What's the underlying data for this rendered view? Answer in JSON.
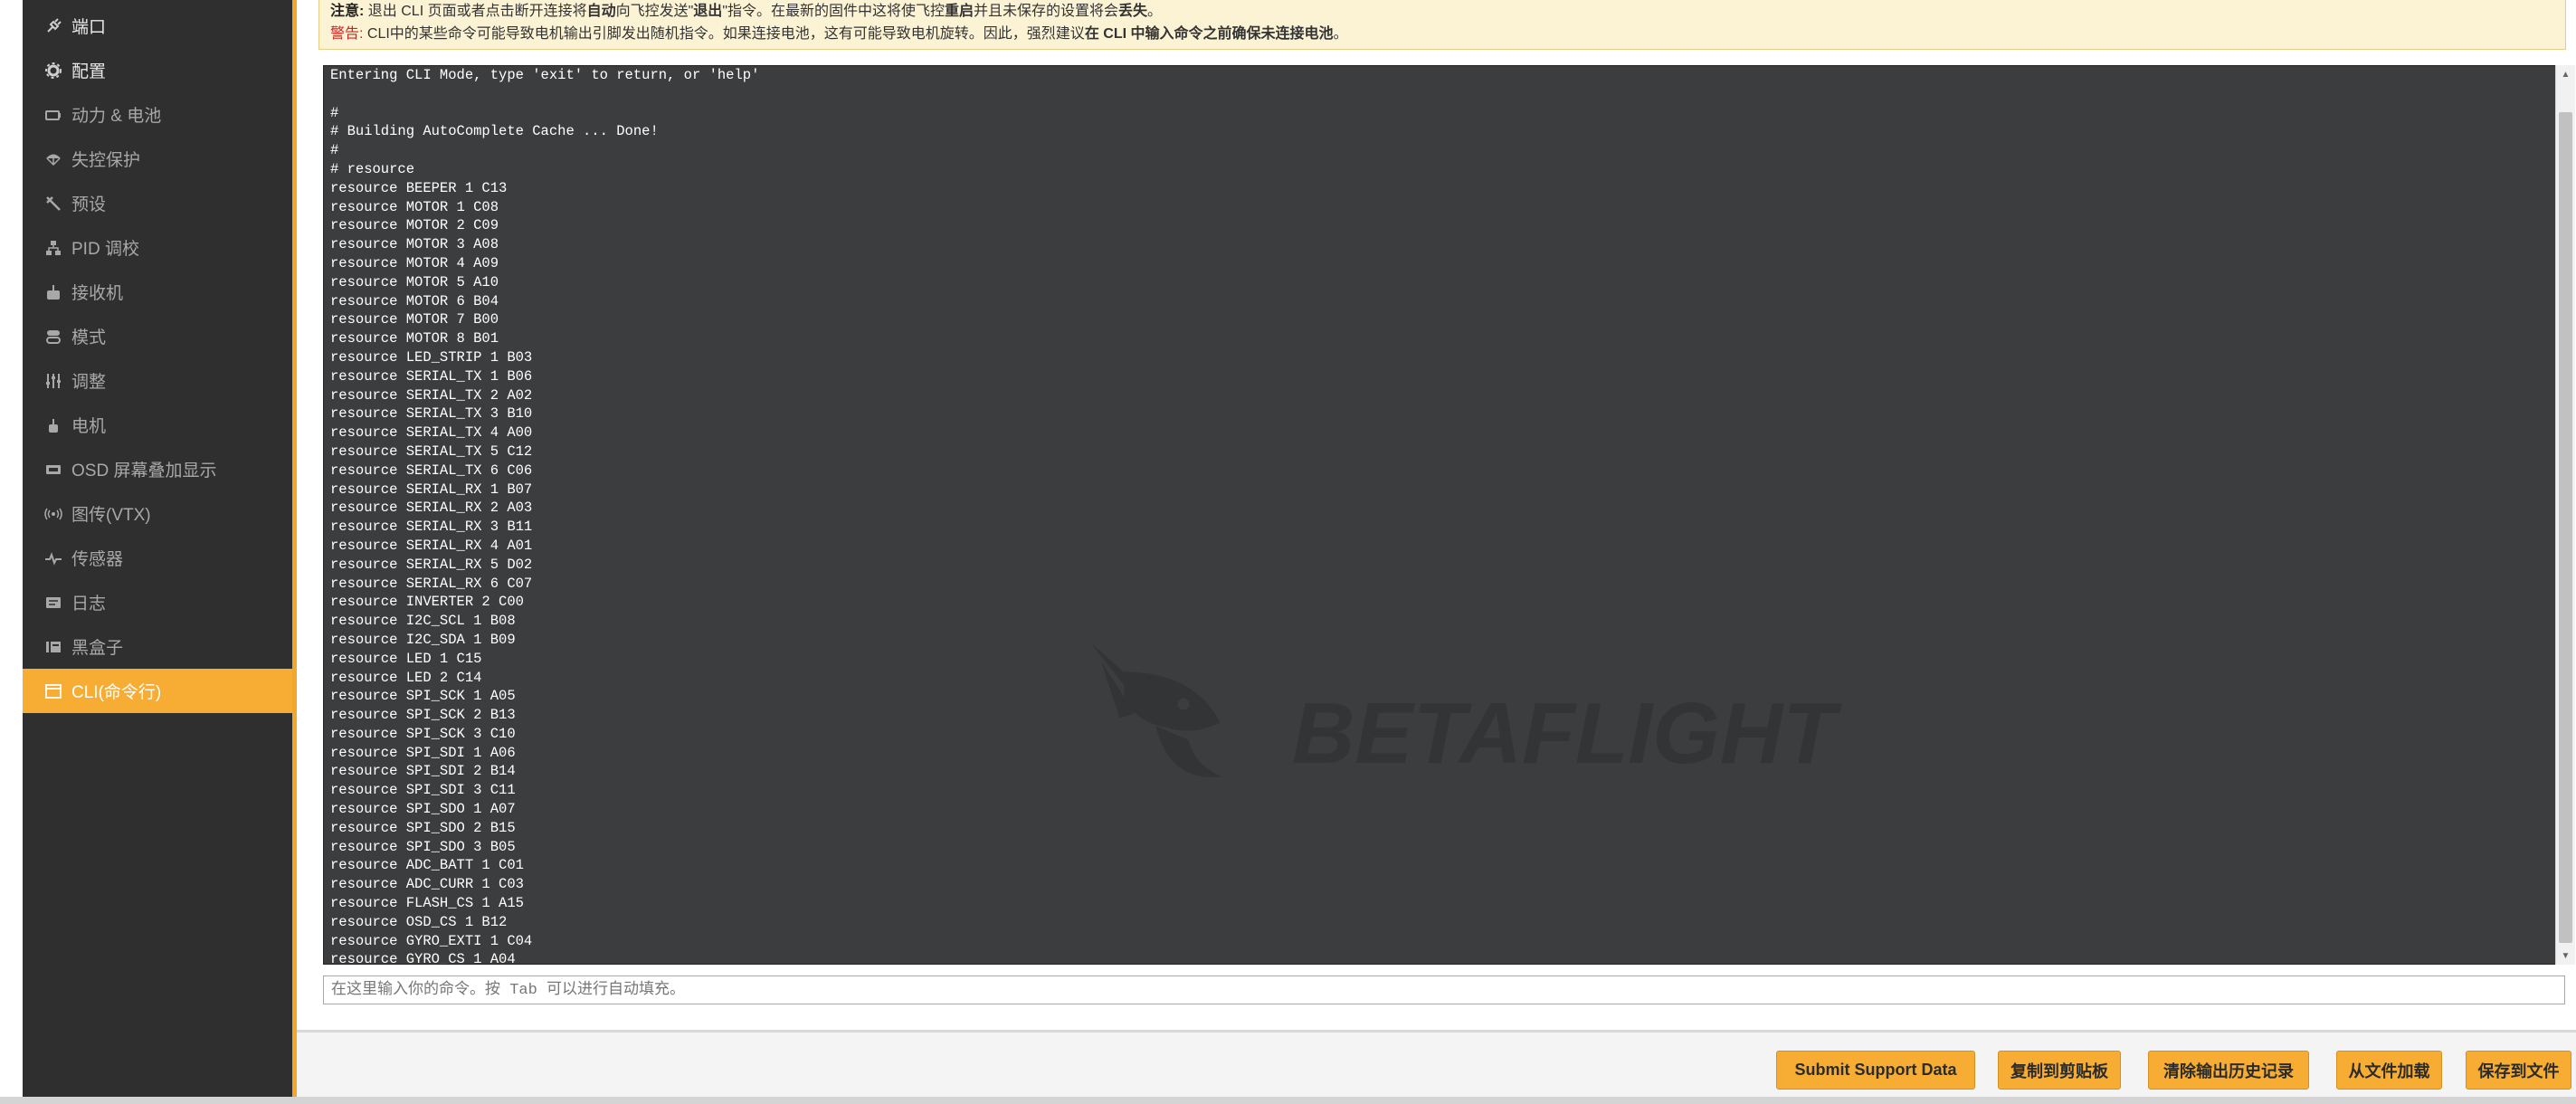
{
  "sidebar": {
    "items": [
      {
        "label": "端口",
        "icon": "plug-icon"
      },
      {
        "label": "配置",
        "icon": "gear-icon"
      },
      {
        "label": "动力 & 电池",
        "icon": "battery-icon"
      },
      {
        "label": "失控保护",
        "icon": "parachute-icon"
      },
      {
        "label": "预设",
        "icon": "tools-icon"
      },
      {
        "label": "PID 调校",
        "icon": "pid-icon"
      },
      {
        "label": "接收机",
        "icon": "receiver-icon"
      },
      {
        "label": "模式",
        "icon": "switches-icon"
      },
      {
        "label": "调整",
        "icon": "sliders-icon"
      },
      {
        "label": "电机",
        "icon": "motor-icon"
      },
      {
        "label": "OSD 屏幕叠加显示",
        "icon": "osd-icon"
      },
      {
        "label": "图传(VTX)",
        "icon": "vtx-icon"
      },
      {
        "label": "传感器",
        "icon": "sensor-icon"
      },
      {
        "label": "日志",
        "icon": "log-icon"
      },
      {
        "label": "黑盒子",
        "icon": "blackbox-icon"
      },
      {
        "label": "CLI(命令行)",
        "icon": "cli-icon",
        "active": true
      }
    ]
  },
  "notice": {
    "note_label": "注意:",
    "note_text_1": " 退出 CLI 页面或者点击断开连接将",
    "note_bold_1": "自动",
    "note_text_2": "向飞控发送\"",
    "note_bold_2": "退出",
    "note_text_3": "\"指令。在最新的固件中这将使飞控",
    "note_bold_3": "重启",
    "note_text_4": "并且未保存的设置将会",
    "note_bold_4": "丢失",
    "note_text_5": "。",
    "warn_label": "警告:",
    "warn_text_1": " CLI中的某些命令可能导致电机输出引脚发出随机指令。如果连接电池，这有可能导致电机旋转。因此，强烈建议",
    "warn_bold": "在 CLI 中输入命令之前确保未连接电池",
    "warn_text_2": "。"
  },
  "console": {
    "lines": [
      "Entering CLI Mode, type 'exit' to return, or 'help'",
      "",
      "#",
      "# Building AutoComplete Cache ... Done!",
      "#",
      "# resource",
      "resource BEEPER 1 C13",
      "resource MOTOR 1 C08",
      "resource MOTOR 2 C09",
      "resource MOTOR 3 A08",
      "resource MOTOR 4 A09",
      "resource MOTOR 5 A10",
      "resource MOTOR 6 B04",
      "resource MOTOR 7 B00",
      "resource MOTOR 8 B01",
      "resource LED_STRIP 1 B03",
      "resource SERIAL_TX 1 B06",
      "resource SERIAL_TX 2 A02",
      "resource SERIAL_TX 3 B10",
      "resource SERIAL_TX 4 A00",
      "resource SERIAL_TX 5 C12",
      "resource SERIAL_TX 6 C06",
      "resource SERIAL_RX 1 B07",
      "resource SERIAL_RX 2 A03",
      "resource SERIAL_RX 3 B11",
      "resource SERIAL_RX 4 A01",
      "resource SERIAL_RX 5 D02",
      "resource SERIAL_RX 6 C07",
      "resource INVERTER 2 C00",
      "resource I2C_SCL 1 B08",
      "resource I2C_SDA 1 B09",
      "resource LED 1 C15",
      "resource LED 2 C14",
      "resource SPI_SCK 1 A05",
      "resource SPI_SCK 2 B13",
      "resource SPI_SCK 3 C10",
      "resource SPI_SDI 1 A06",
      "resource SPI_SDI 2 B14",
      "resource SPI_SDI 3 C11",
      "resource SPI_SDO 1 A07",
      "resource SPI_SDO 2 B15",
      "resource SPI_SDO 3 B05",
      "resource ADC_BATT 1 C01",
      "resource ADC_CURR 1 C03",
      "resource FLASH_CS 1 A15",
      "resource OSD_CS 1 B12",
      "resource GYRO_EXTI 1 C04",
      "resource GYRO_CS 1 A04"
    ],
    "watermark_text": "BETAFLIGHT"
  },
  "command_input": {
    "placeholder": "在这里输入你的命令。按 Tab 可以进行自动填充。"
  },
  "footer": {
    "buttons": {
      "submit_support": "Submit Support Data",
      "copy_clipboard": "复制到剪贴板",
      "clear_history": "清除输出历史记录",
      "load_file": "从文件加载",
      "save_file": "保存到文件"
    }
  },
  "colors": {
    "accent": "#f7ad33",
    "sidebar_bg": "#2f2f2f",
    "console_bg": "#3c3d3f",
    "warning_red": "#d32020",
    "notice_bg": "#fcf3d5"
  }
}
